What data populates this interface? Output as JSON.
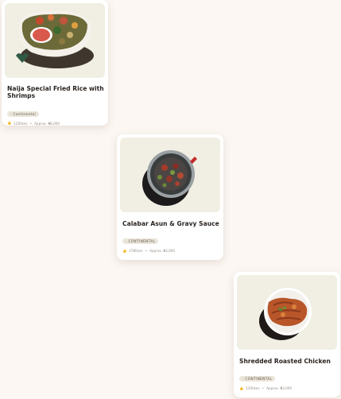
{
  "dishes": [
    {
      "name": "Naija Special Fried Rice with Shrimps",
      "tag": "· Continental",
      "likes": "120likes",
      "separator": "•",
      "price": "Approx. ₦8,000",
      "image_icon": "fried-rice-bowl-image"
    },
    {
      "name": "Calabar Asun & Gravy Sauce",
      "tag": "· CONTINENTAL",
      "likes": "278likes",
      "separator": "•",
      "price": "Approx. ₦3,000",
      "image_icon": "asun-pan-image"
    },
    {
      "name": "Shredded Roasted Chicken",
      "tag": "· CONTINENTAL",
      "likes": "120likes",
      "separator": "•",
      "price": "Approx. ₦3,000",
      "image_icon": "roasted-chicken-plate-image"
    }
  ],
  "colors": {
    "background": "#fcf7f3",
    "image_backdrop": "#f1efe3",
    "tag_bg": "#ebe6da",
    "heart_badge": "#2f5a45"
  },
  "icons": {
    "likes": "thumbs-up-icon",
    "favorite": "heart-icon"
  }
}
